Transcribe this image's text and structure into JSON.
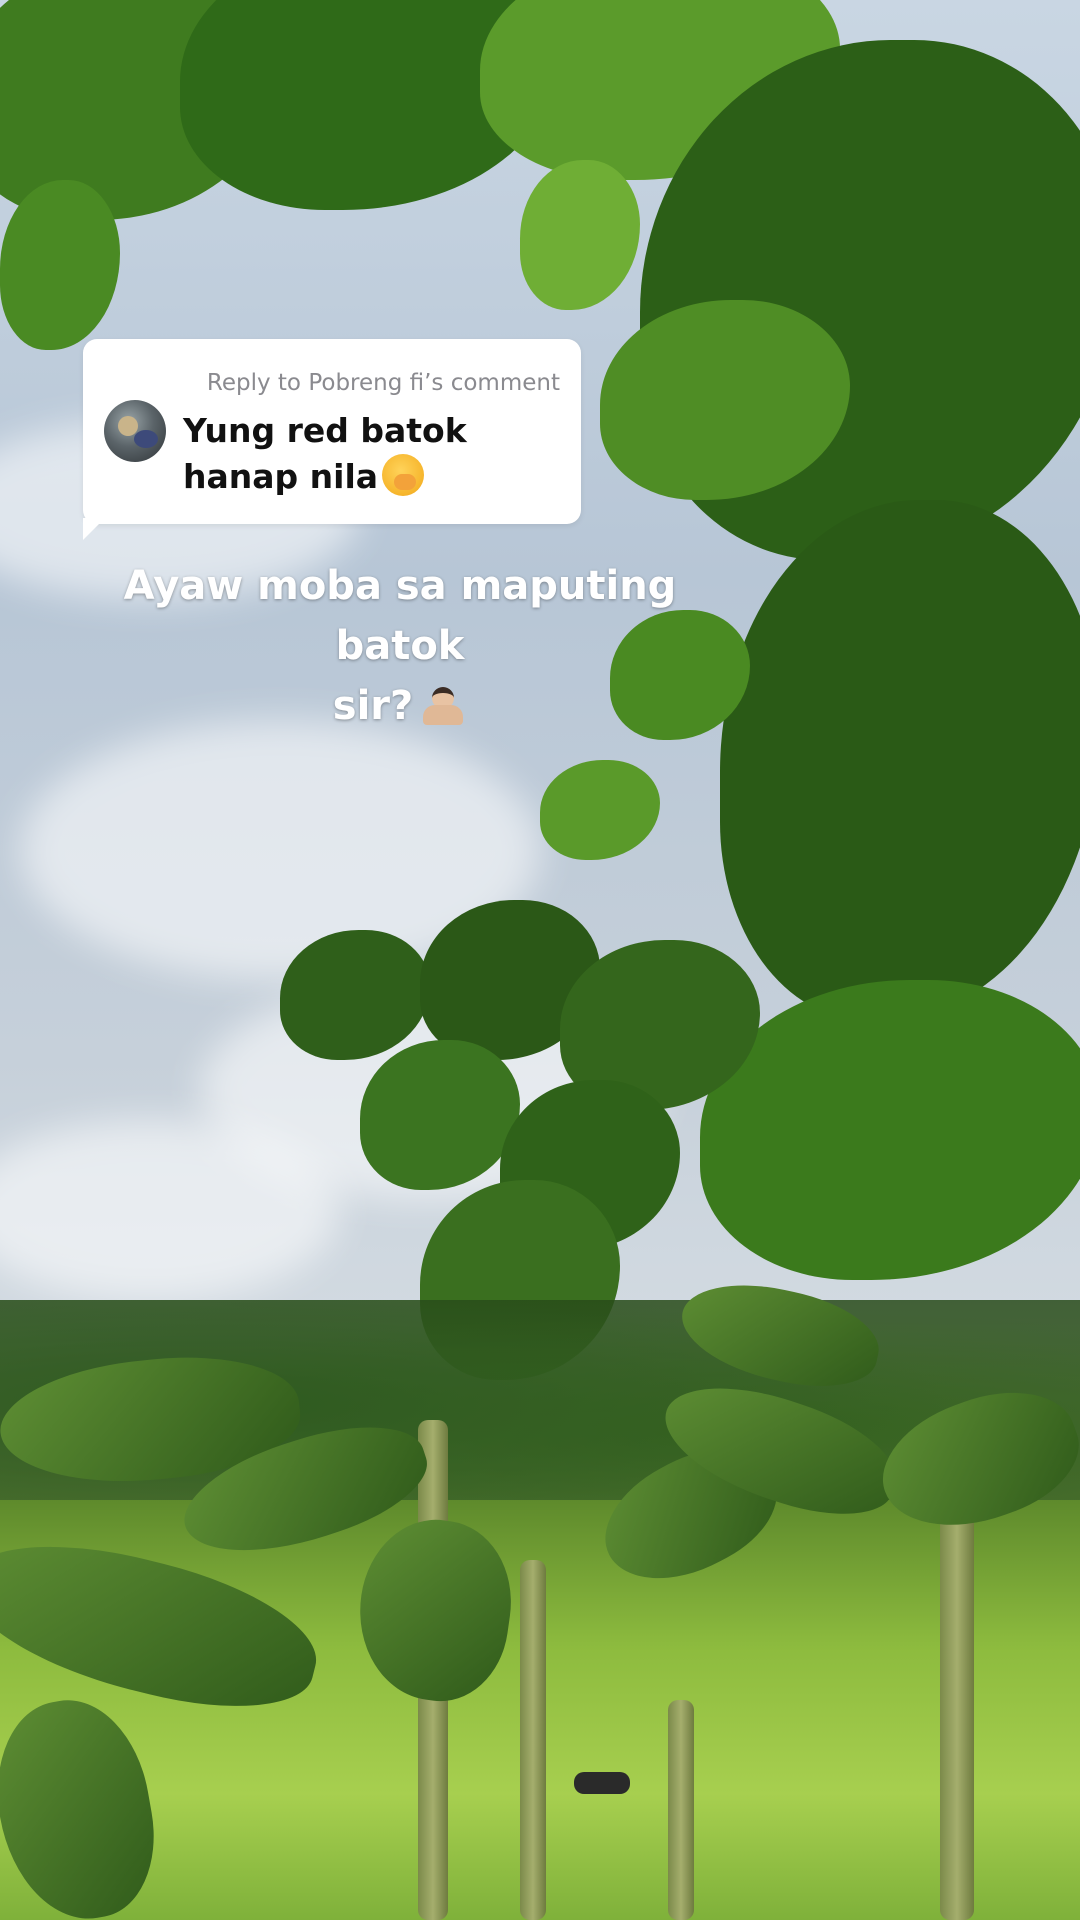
{
  "reply": {
    "header": "Reply to Pobreng fi’s comment",
    "line1": "Yung red batok",
    "line2": "hanap nila",
    "emoji": "hand-over-mouth-emoji"
  },
  "caption": {
    "line1": "Ayaw moba sa maputing batok",
    "line2": "sir?",
    "emoji": "person-bowing-emoji"
  },
  "colors": {
    "card_bg": "#ffffff",
    "header_text": "#8a8a8f",
    "body_text": "#111111",
    "caption_text": "#ffffff"
  }
}
